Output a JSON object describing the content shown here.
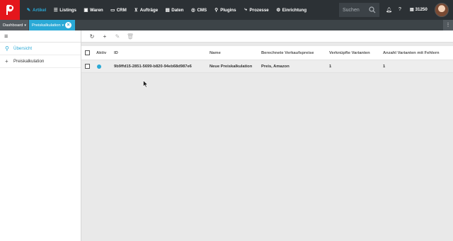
{
  "brand": {
    "accent": "#2aa9d6",
    "logo_color": "#e4161c"
  },
  "nav": {
    "items": [
      {
        "label": "Artikel",
        "icon": "tag-icon",
        "active": true
      },
      {
        "label": "Listings",
        "icon": "list-icon"
      },
      {
        "label": "Waren",
        "icon": "truck-icon"
      },
      {
        "label": "CRM",
        "icon": "contacts-icon"
      },
      {
        "label": "Aufträge",
        "icon": "cart-icon"
      },
      {
        "label": "Daten",
        "icon": "database-icon"
      },
      {
        "label": "CMS",
        "icon": "cms-icon"
      },
      {
        "label": "Plugins",
        "icon": "plug-icon"
      },
      {
        "label": "Prozesse",
        "icon": "process-icon"
      },
      {
        "label": "Einrichtung",
        "icon": "gear-icon"
      }
    ],
    "search_placeholder": "Suchen",
    "account_number": "31250"
  },
  "tabs": {
    "dashboard": "Dashboard",
    "active": "Preiskalkulation"
  },
  "sidebar": {
    "items": [
      {
        "label": "Übersicht",
        "icon": "search-icon",
        "active": true
      },
      {
        "label": "Preiskalkulation",
        "icon": "plus-icon"
      }
    ]
  },
  "table": {
    "columns": {
      "active": "Aktiv",
      "id": "ID",
      "name": "Name",
      "prices": "Berechnete Verkaufspreise",
      "variants": "Verknüpfte Varianten",
      "errors": "Anzahl Varianten mit Fehlern"
    },
    "rows": [
      {
        "active": true,
        "id": "9b9ffd15-2851-5699-b820-94eb68d987e6",
        "name": "Neue Preiskalkulation",
        "prices": "Preis, Amazon",
        "variants": "1",
        "errors": "1"
      }
    ]
  }
}
